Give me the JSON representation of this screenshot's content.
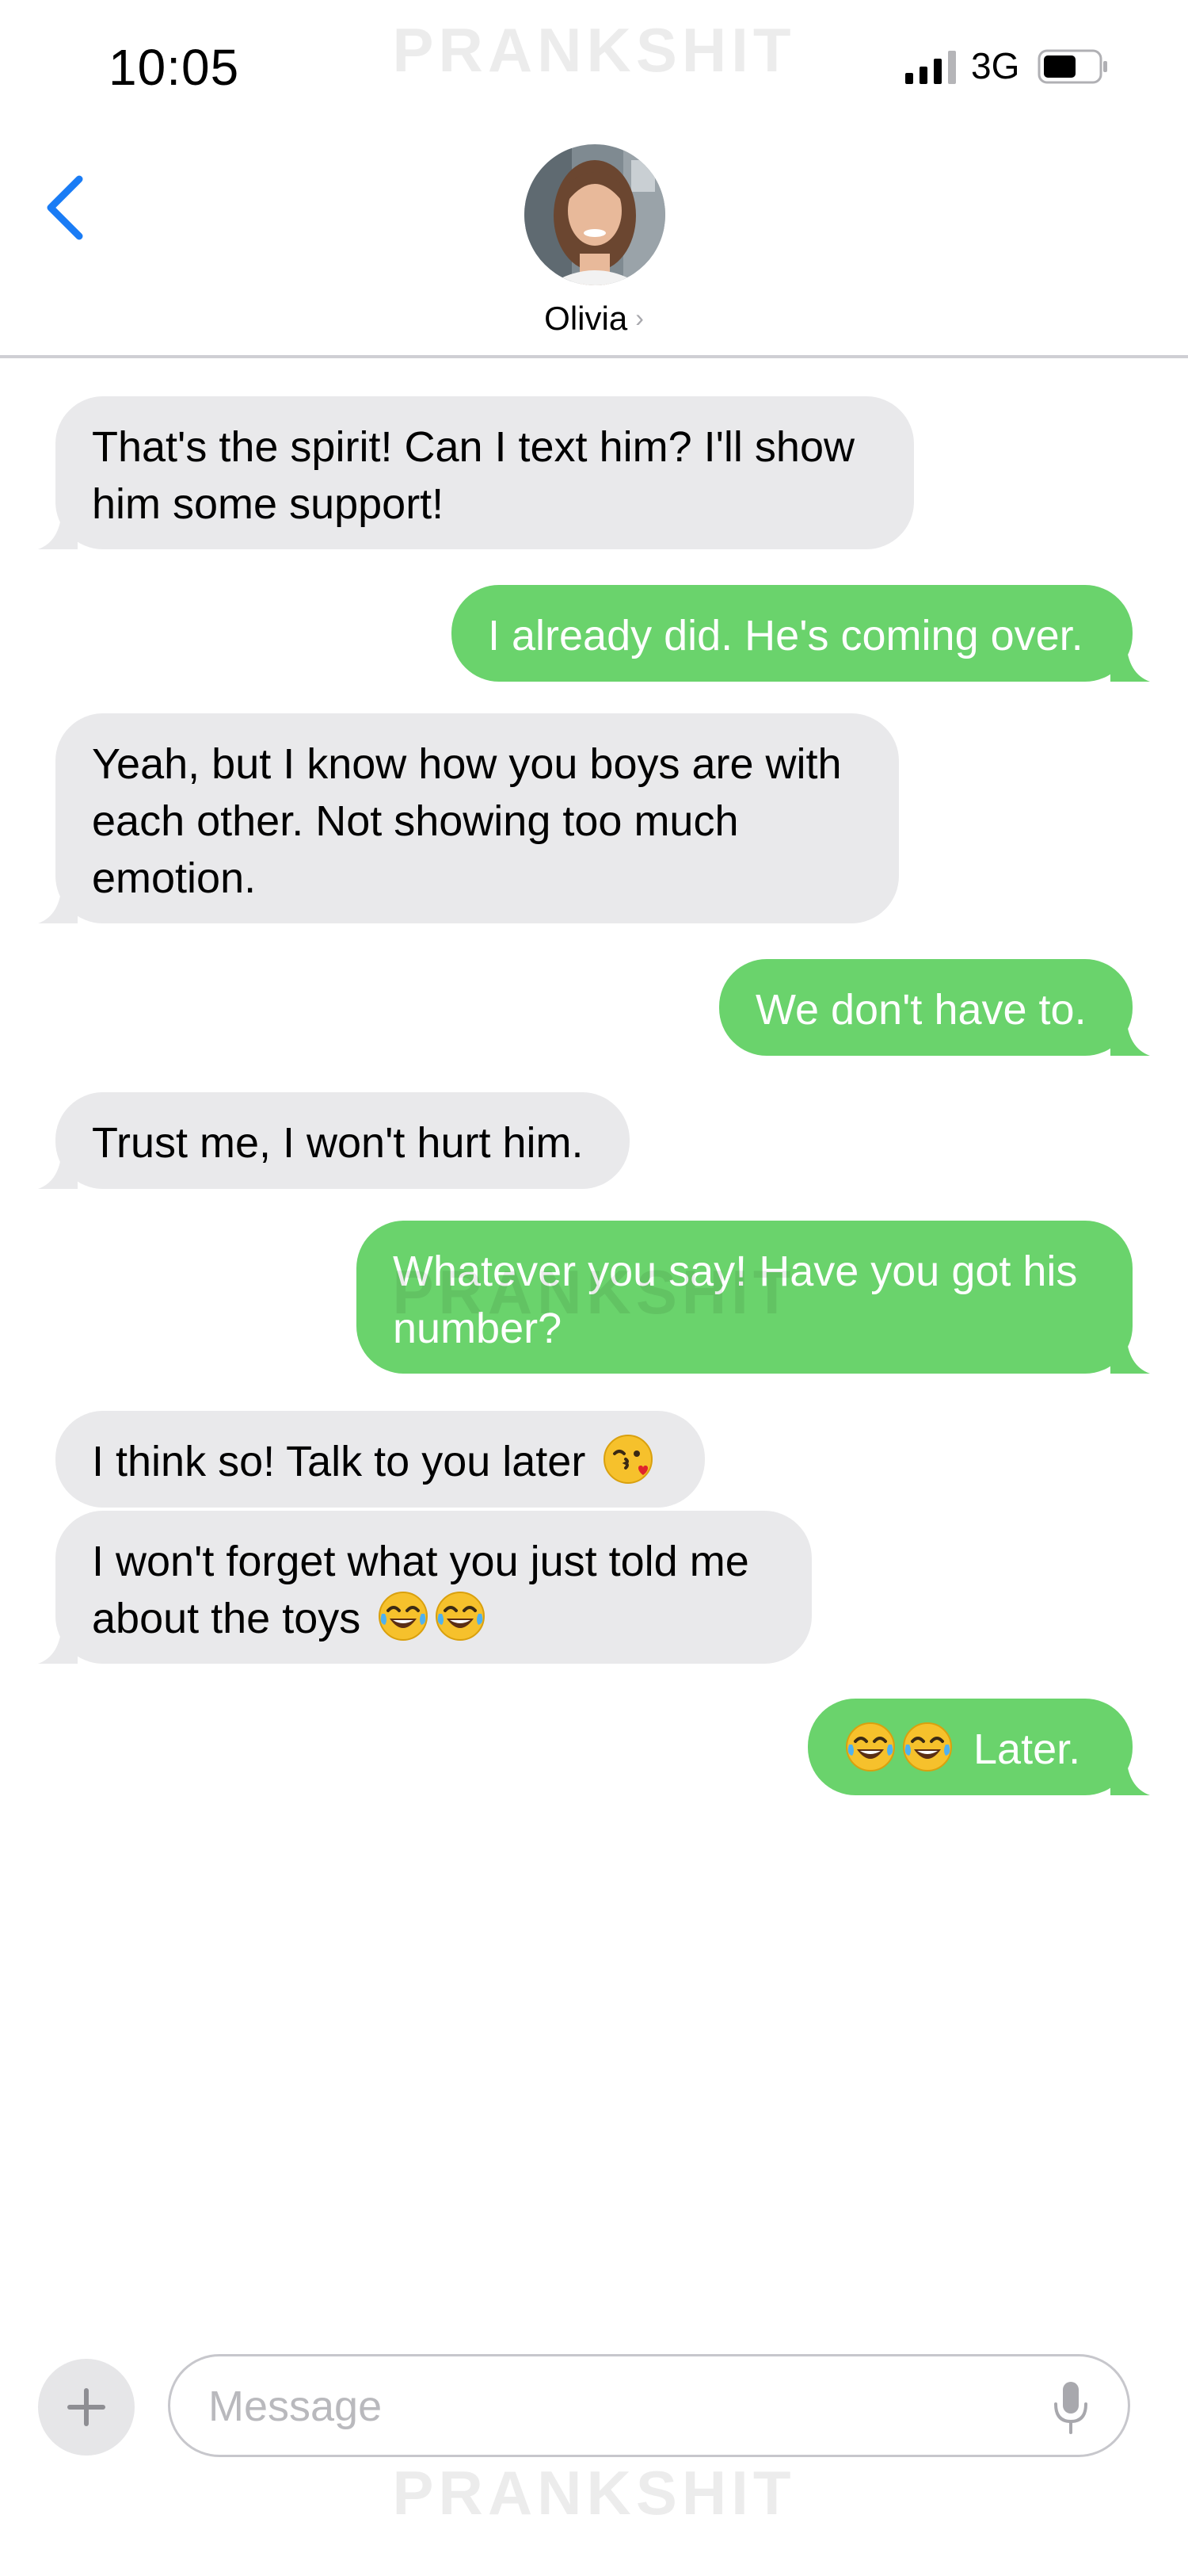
{
  "status_bar": {
    "time": "10:05",
    "network": "3G",
    "watermark": "PRANKSHIT",
    "icons": [
      "signal-bars-icon",
      "battery-icon"
    ]
  },
  "header": {
    "contact_name": "Olivia",
    "chevron": "›",
    "icons": [
      "back-chevron-icon",
      "avatar"
    ]
  },
  "messages": [
    {
      "direction": "received",
      "text": "That's the spirit! Can I text him? I'll show him some support!"
    },
    {
      "direction": "sent",
      "text": "I already did. He's coming over."
    },
    {
      "direction": "received",
      "text": "Yeah, but I know how you boys are with each other. Not showing too much emotion."
    },
    {
      "direction": "sent",
      "text": "We don't have to."
    },
    {
      "direction": "received",
      "text": "Trust me, I won't hurt him."
    },
    {
      "direction": "sent",
      "text": "Whatever you say! Have you got his number?"
    },
    {
      "direction": "received",
      "text": "I think so! Talk to you later",
      "emoji": [
        "kissing-wink-emoji"
      ]
    },
    {
      "direction": "received",
      "text": "I won't forget what you just told me about the toys",
      "emoji": [
        "tears-of-joy-emoji",
        "tears-of-joy-emoji"
      ]
    },
    {
      "direction": "sent",
      "text": "Later.",
      "emoji_before": [
        "tears-of-joy-emoji",
        "tears-of-joy-emoji"
      ]
    }
  ],
  "composer": {
    "placeholder": "Message",
    "icons": [
      "plus-icon",
      "microphone-icon"
    ]
  },
  "colors": {
    "sent_bubble": "#6ad36c",
    "received_bubble": "#e9e9eb",
    "accent_blue": "#1a7cf5"
  }
}
